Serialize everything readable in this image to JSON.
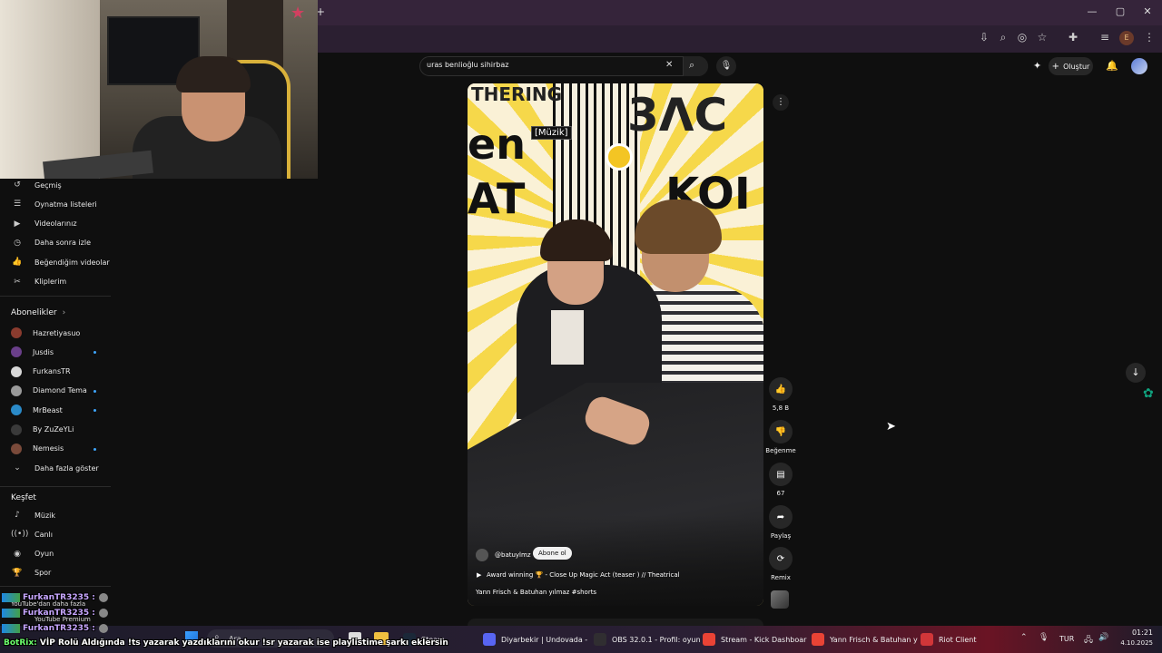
{
  "browser": {
    "new_tab": "+",
    "win_minimize": "—",
    "win_maximize": "▢",
    "win_close": "✕",
    "profile_letter": "E"
  },
  "youtube": {
    "search": {
      "value": "uras benlioğlu sihirbaz"
    },
    "create_label": "Oluştur",
    "sidebar": {
      "you_items": [
        {
          "label": "Geçmiş",
          "icon": "history-icon"
        },
        {
          "label": "Oynatma listeleri",
          "icon": "playlist-icon"
        },
        {
          "label": "Videolarınız",
          "icon": "video-icon"
        },
        {
          "label": "Daha sonra izle",
          "icon": "clock-icon"
        },
        {
          "label": "Beğendiğim videolar",
          "icon": "thumb-up-icon"
        },
        {
          "label": "Kliplerim",
          "icon": "scissors-icon"
        }
      ],
      "subscriptions_header": "Abonelikler",
      "subscriptions": [
        {
          "label": "Hazretiyasuo",
          "color": "#8a3b2e",
          "new": false
        },
        {
          "label": "Jusdis",
          "color": "#6a3f8a",
          "new": true
        },
        {
          "label": "FurkansTR",
          "color": "#d8d8d8",
          "new": false
        },
        {
          "label": "Diamond Tema",
          "color": "#9a9a9a",
          "new": true
        },
        {
          "label": "MrBeast",
          "color": "#2a8ac8",
          "new": true
        },
        {
          "label": "By ZuZeYLi",
          "color": "#3a3a3a",
          "new": false
        },
        {
          "label": "Nemesis",
          "color": "#7a4a3a",
          "new": true
        }
      ],
      "show_more": "Daha fazla göster",
      "explore_header": "Keşfet",
      "explore_items": [
        {
          "label": "Müzik",
          "icon": "music-icon"
        },
        {
          "label": "Canlı",
          "icon": "live-icon"
        },
        {
          "label": "Oyun",
          "icon": "gamepad-icon"
        },
        {
          "label": "Spor",
          "icon": "trophy-icon"
        }
      ],
      "more_from_youtube": "YouTube'dan daha fazla",
      "premium": "YouTube Premium"
    },
    "short": {
      "caption_tag": "[Müzik]",
      "sign_top_left": "THERING",
      "sign_top_right": "3ΛC",
      "sign_mid_left": "en",
      "sign_bottom_left": "AT",
      "sign_bottom_right": "KOI",
      "channel": "@batuylmz",
      "subscribe": "Abone ol",
      "title": "Award winning 🏆 - Close Up Magic Act (teaser ) // Theatrical",
      "description": "Yann Frisch & Batuhan yılmaz #shorts"
    },
    "actions": {
      "likes": "5,8 B",
      "dislike": "Beğenme",
      "comments": "67",
      "share": "Paylaş",
      "remix": "Remix"
    }
  },
  "chat_overlay": [
    {
      "user": "FurkanTR3235 :",
      "color": "#c7a6ff"
    },
    {
      "user": "FurkanTR3235 :",
      "color": "#c7a6ff"
    },
    {
      "user": "FurkanTR3235 :",
      "color": "#c7a6ff"
    }
  ],
  "bot_message": {
    "prefix": "BotRix:",
    "text": "VİP Rolü Aldığında !ts yazarak yazdıklarını okur !sr yazarak ise playlistime şarkı eklersin"
  },
  "taskbar": {
    "search": "Ara",
    "items": [
      {
        "label": "Steam",
        "color": "#1b2838"
      },
      {
        "label": "Diyarbekir | Undovada -",
        "color": "#5865f2"
      },
      {
        "label": "OBS 32.0.1 - Profil: oyun",
        "color": "#302e31"
      },
      {
        "label": "Stream - Kick Dashboar",
        "color": "#ea4335"
      },
      {
        "label": "Yann Frisch & Batuhan y",
        "color": "#ea4335"
      },
      {
        "label": "Riot Client",
        "color": "#d13639"
      }
    ],
    "lang": "TUR",
    "time": "01:21",
    "date": "4.10.2025"
  }
}
